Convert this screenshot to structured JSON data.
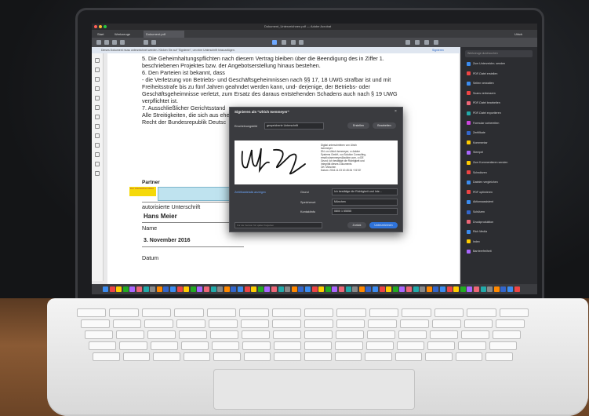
{
  "window": {
    "title": "Dokument_Unterzeichnen.pdf — Adobe Acrobat",
    "tabs": [
      "Start",
      "Werkzeuge",
      "Dokument.pdf"
    ],
    "user": "Ulrich"
  },
  "signbar": {
    "text": "Dieses Dokument muss unterzeichnet werden. Klicken Sie auf \"Signieren\", um eine Unterschrift hinzuzufügen.",
    "button": "Signieren"
  },
  "document": {
    "lines": [
      "5. Die Geheimhaltungspflichten nach diesem Vertrag bleiben über die Beendigung des in Ziffer 1.",
      "beschriebenen Projektes bzw. der Angebotserstellung hinaus bestehen.",
      "6. Den Parteien ist bekannt, dass",
      "- die Verletzung von Betriebs- und Geschäftsgeheimnissen nach §§ 17, 18  UWG strafbar ist und mit",
      "Freiheitsstrafe bis zu fünf Jahren geahndet werden kann, und- derjenige, der Betriebs- oder",
      "Geschäftsgeheimnisse verletzt, zum Ersatz des daraus entstehenden Schadens auch nach § 19 UWG",
      "verpflichtet ist.",
      "7. Ausschließlicher Gerichtsstand",
      "Alle Streitigkeiten, die sich aus                                                                                    ehen dem",
      "Recht der Bundesrepublik Deutsc"
    ],
    "partner_label": "Partner",
    "sign_here": "Zum Unterzeichnen klicken",
    "auth_sig": "autorisierte Unterschrift",
    "name_value": "Hans Meier",
    "name_label": "Name",
    "date_value": "3. November 2016",
    "date_label": "Datum"
  },
  "dialog": {
    "title": "Signieren als \"Ulrich Isenmeyer\"",
    "appearance_label": "Erscheinungsbild",
    "appearance_value": "gespeicherte Unterschrift",
    "btn_create": "Erstellen",
    "btn_edit": "Bearbeiten",
    "sig_info": [
      "Digital unterschrieben von Ulrich",
      "Isenmeyer",
      "DN: cn=Ulrich Isenmeyer, o=Adobe",
      "Systems GmbH, ou=Solution Consulting,",
      "email=uisenmeyer@adobe.com, c=DE",
      "Grund: Ich bestätige die Richtigkeit und",
      "Integrität dieses Dokuments",
      "Ort: München",
      "Datum: 2016.11.03 10:45:34 +01'00'"
    ],
    "cert_link": "Zertifikatdetails anzeigen",
    "reason_label": "Grund",
    "reason_value": "Ich bestätige die Richtigkeit und Inte...",
    "location_label": "Speicherort",
    "location_value": "München",
    "contact_label": "Kontaktinfo",
    "contact_value": "0800 1 55555",
    "lock_placeholder": "Für die Version für später freigeben",
    "btn_back": "Zurück",
    "btn_sign": "Unterzeichnen"
  },
  "rpanel": {
    "search": "Werkzeuge durchsuchen",
    "items": [
      {
        "label": "Zum Unterzeichn. senden",
        "color": "#3b8cf0"
      },
      {
        "label": "PDF-Datei erstellen",
        "color": "#e44"
      },
      {
        "label": "Seiten verwalten",
        "color": "#3b8cf0"
      },
      {
        "label": "Scans verbessern",
        "color": "#e44"
      },
      {
        "label": "PDF-Datei bearbeiten",
        "color": "#e67"
      },
      {
        "label": "PDF-Datei exportieren",
        "color": "#2aa"
      },
      {
        "label": "Formular vorbereiten",
        "color": "#c4d"
      },
      {
        "label": "Zertifikate",
        "color": "#36c"
      },
      {
        "label": "Kommentar",
        "color": "#fc0"
      },
      {
        "label": "Stempel",
        "color": "#a6f"
      },
      {
        "label": "Zum Kommentieren senden",
        "color": "#fc0"
      },
      {
        "label": "Schwärzen",
        "color": "#e44"
      },
      {
        "label": "Dateien vergleichen",
        "color": "#3b8cf0"
      },
      {
        "label": "PDF optimieren",
        "color": "#e44"
      },
      {
        "label": "Aktionsassistent",
        "color": "#3b8cf0"
      },
      {
        "label": "Schützen",
        "color": "#36c"
      },
      {
        "label": "Druckproduktion",
        "color": "#e67"
      },
      {
        "label": "Rich Media",
        "color": "#3b8cf0"
      },
      {
        "label": "Index",
        "color": "#fc0"
      },
      {
        "label": "Barrierefreiheit",
        "color": "#a6f"
      }
    ]
  }
}
